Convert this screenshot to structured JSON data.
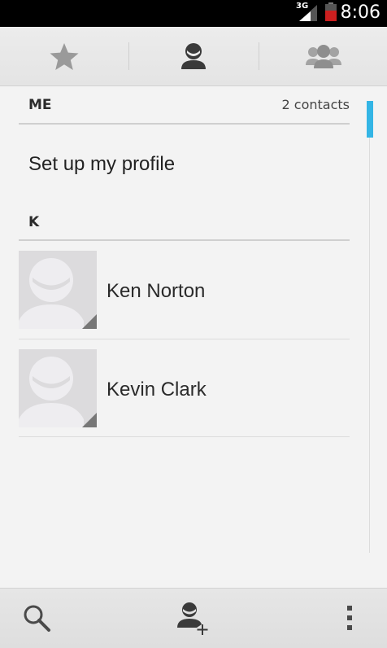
{
  "status_bar": {
    "network": "3G",
    "time": "8:06"
  },
  "tabs": [
    {
      "name": "favorites",
      "icon": "star-icon",
      "active": false
    },
    {
      "name": "contacts",
      "icon": "person-icon",
      "active": true
    },
    {
      "name": "groups",
      "icon": "group-icon",
      "active": false
    }
  ],
  "sections": {
    "me": {
      "title": "ME",
      "count": "2 contacts"
    },
    "profile_label": "Set up my profile",
    "k": {
      "title": "K"
    }
  },
  "contacts": [
    {
      "name": "Ken Norton"
    },
    {
      "name": "Kevin Clark"
    }
  ],
  "bottom_bar": {
    "search": "search-icon",
    "add_contact": "add-contact-icon",
    "menu": "overflow-menu-icon"
  },
  "colors": {
    "accent": "#33b5e5",
    "icon_dark": "#3a3a3a",
    "icon_light": "#9a9a9a"
  }
}
